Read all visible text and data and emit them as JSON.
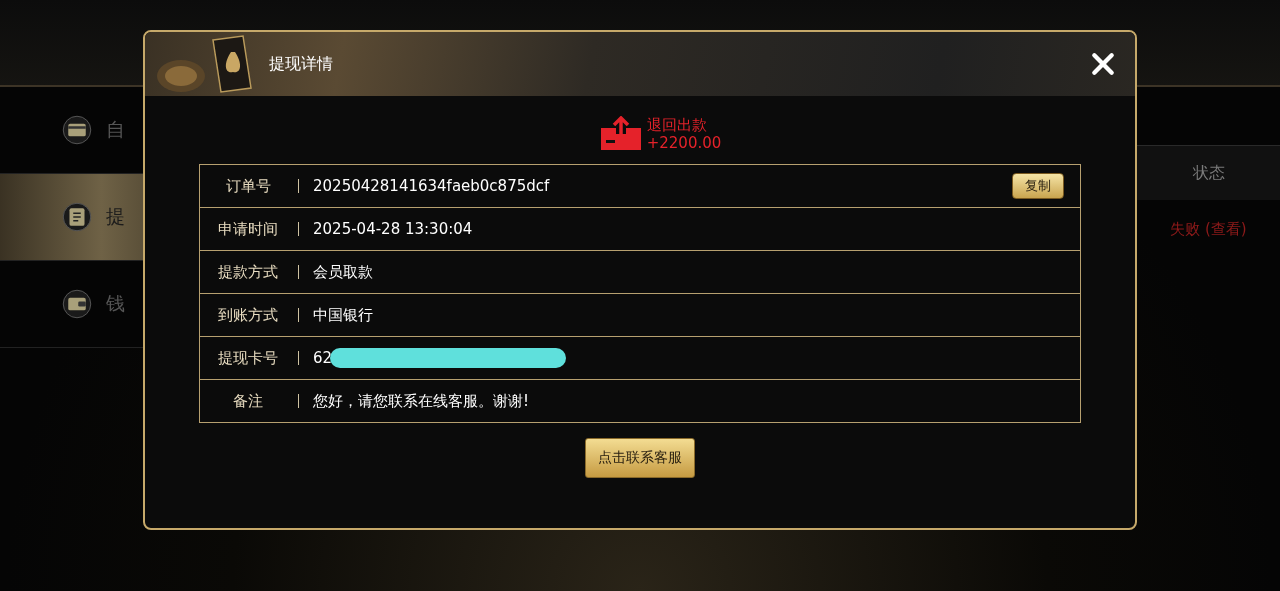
{
  "sidebar": {
    "items": [
      {
        "label": "自",
        "selected": false
      },
      {
        "label": "提",
        "selected": true
      },
      {
        "label": "钱",
        "selected": false
      }
    ]
  },
  "records": {
    "columns": [
      "状态"
    ],
    "rows": [
      {
        "status": "失败 (查看)"
      }
    ]
  },
  "dialog": {
    "title": "提现详情",
    "result": {
      "label": "退回出款",
      "amount": "+2200.00"
    },
    "details": [
      {
        "label": "订单号",
        "value": "20250428141634faeb0c875dcf",
        "action": "复制",
        "redacted": false
      },
      {
        "label": "申请时间",
        "value": "2025-04-28 13:30:04",
        "redacted": false
      },
      {
        "label": "提款方式",
        "value": "会员取款",
        "redacted": false
      },
      {
        "label": "到账方式",
        "value": "中国银行",
        "redacted": false
      },
      {
        "label": "提现卡号",
        "value": "62",
        "redacted": true
      },
      {
        "label": "备注",
        "value": "您好，请您联系在线客服。谢谢!",
        "redacted": false
      }
    ],
    "button": "点击联系客服"
  }
}
